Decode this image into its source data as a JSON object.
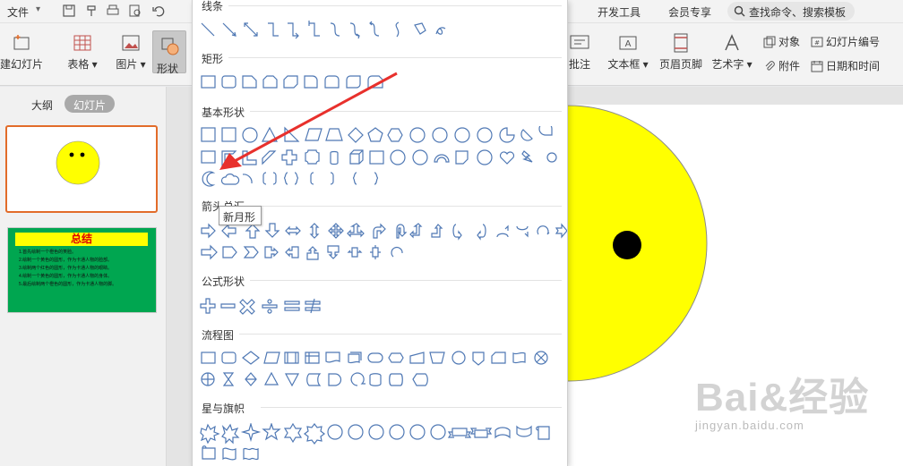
{
  "menubar": {
    "file": "文件",
    "tabs": [
      "开发工具",
      "会员专享"
    ],
    "search_placeholder": "查找命令、搜索模板"
  },
  "ribbon": {
    "new_slide": "建幻灯片",
    "table": "表格",
    "picture": "图片",
    "shape": "形状",
    "comment": "批注",
    "textbox": "文本框",
    "header_footer": "页眉页脚",
    "wordart": "艺术字",
    "object": "对象",
    "attachment": "附件",
    "slide_number": "幻灯片编号",
    "date_time": "日期和时间"
  },
  "left_panel": {
    "tabs": [
      "大纲",
      "幻灯片"
    ],
    "slide2": {
      "title": "总结",
      "lines": [
        "1.首先绘制一个橙色的笑脸。",
        "2.绘制一个黄色的圆形，作为卡通人物的脸部。",
        "3.绘制两个红色的圆形，作为卡通人物的眼睛。",
        "4.绘制一个黄色的圆形，作为卡通人物的身体。",
        "5.最后绘制两个橙色的圆形，作为卡通人物的脚。"
      ]
    }
  },
  "shapes_panel": {
    "sections": [
      "线条",
      "矩形",
      "基本形状",
      "箭头总汇",
      "公式形状",
      "流程图",
      "星与旗帜"
    ],
    "tooltip": "新月形"
  },
  "watermark": {
    "brand": "Bai&经验",
    "url": "jingyan.baidu.com"
  },
  "colors": {
    "accent": "#e26c2a",
    "shape_outline": "#4f78b4",
    "face_yellow": "#ffff00",
    "arrow_red": "#e8302c"
  }
}
